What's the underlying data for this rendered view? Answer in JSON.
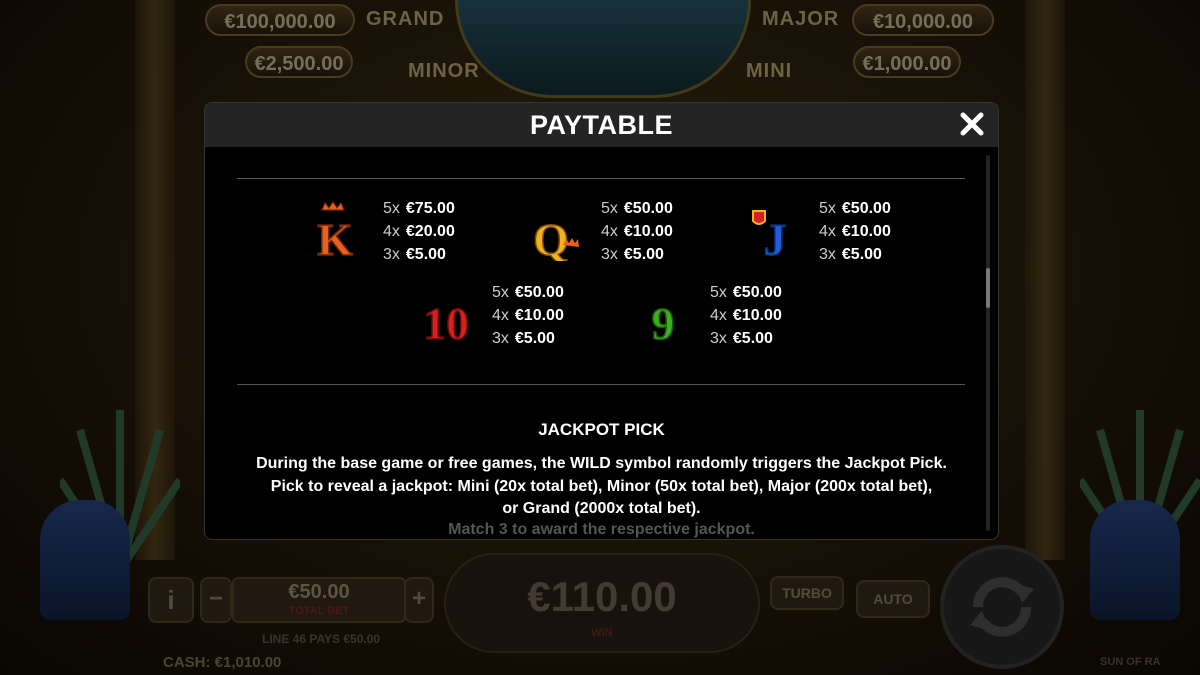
{
  "jackpots": {
    "grand": {
      "value": "€100,000.00",
      "label": "GRAND"
    },
    "major": {
      "value": "€10,000.00",
      "label": "MAJOR"
    },
    "minor": {
      "value": "€2,500.00",
      "label": "MINOR"
    },
    "mini": {
      "value": "€1,000.00",
      "label": "MINI"
    }
  },
  "modal": {
    "title": "PAYTABLE",
    "close_icon": "close-x-icon"
  },
  "paytable": [
    {
      "symbol": "K",
      "icon": "king-card-icon",
      "color": "#e8601a",
      "pays": [
        {
          "mult": "5x",
          "value": "€75.00"
        },
        {
          "mult": "4x",
          "value": "€20.00"
        },
        {
          "mult": "3x",
          "value": "€5.00"
        }
      ]
    },
    {
      "symbol": "Q",
      "icon": "queen-card-icon",
      "color": "#f2b21a",
      "pays": [
        {
          "mult": "5x",
          "value": "€50.00"
        },
        {
          "mult": "4x",
          "value": "€10.00"
        },
        {
          "mult": "3x",
          "value": "€5.00"
        }
      ]
    },
    {
      "symbol": "J",
      "icon": "jack-card-icon",
      "color": "#1e5fd8",
      "pays": [
        {
          "mult": "5x",
          "value": "€50.00"
        },
        {
          "mult": "4x",
          "value": "€10.00"
        },
        {
          "mult": "3x",
          "value": "€5.00"
        }
      ]
    },
    {
      "symbol": "10",
      "icon": "ten-card-icon",
      "color": "#d81e1e",
      "pays": [
        {
          "mult": "5x",
          "value": "€50.00"
        },
        {
          "mult": "4x",
          "value": "€10.00"
        },
        {
          "mult": "3x",
          "value": "€5.00"
        }
      ]
    },
    {
      "symbol": "9",
      "icon": "nine-card-icon",
      "color": "#3fae1e",
      "pays": [
        {
          "mult": "5x",
          "value": "€50.00"
        },
        {
          "mult": "4x",
          "value": "€10.00"
        },
        {
          "mult": "3x",
          "value": "€5.00"
        }
      ]
    }
  ],
  "jackpot_pick": {
    "heading": "JACKPOT PICK",
    "line1": "During the base game or free games, the WILD symbol randomly triggers the Jackpot Pick.",
    "line2": "Pick to reveal a jackpot: Mini (20x total bet), Minor (50x total bet), Major (200x total bet),",
    "line3": "or Grand (2000x total bet).",
    "line4": "Match 3 to award the respective jackpot."
  },
  "controls": {
    "info_label": "i",
    "minus_label": "−",
    "plus_label": "+",
    "total_bet_value": "€50.00",
    "total_bet_label": "TOTAL BET",
    "lines_info": "LINE 46 PAYS €50.00",
    "win_value": "€110.00",
    "win_label": "WIN",
    "turbo_label": "TURBO",
    "auto_label": "AUTO",
    "cash_text": "CASH: €1,010.00",
    "game_name": "SUN OF RA"
  }
}
